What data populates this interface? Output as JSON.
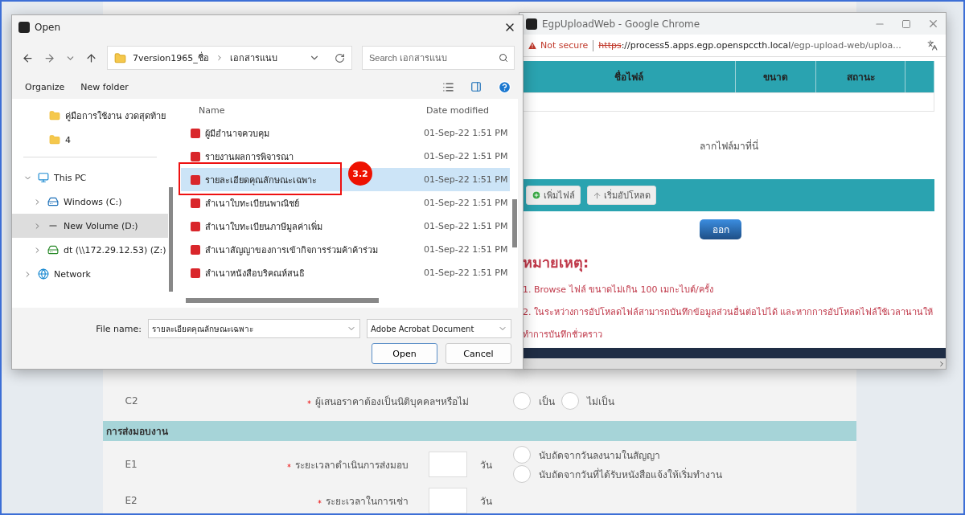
{
  "open_dialog": {
    "title": "Open",
    "path": [
      "7version1965_ชื่อ",
      "เอกสารแนบ"
    ],
    "search": {
      "placeholder": "Search เอกสารแนบ"
    },
    "toolbar": [
      "Organize",
      "New folder"
    ],
    "nav": [
      {
        "label": "คู่มือการใช้งาน งวดสุดท้าย",
        "kind": "folder",
        "selected": false
      },
      {
        "label": "4",
        "kind": "folder",
        "selected": false
      },
      {
        "label": "This PC",
        "kind": "pc",
        "selected": false,
        "expanded": true,
        "children": [
          {
            "label": "Windows (C:)",
            "kind": "system-drive",
            "selected": false,
            "expanded": false
          },
          {
            "label": "New Volume (D:)",
            "kind": "drive",
            "selected": true,
            "expanded": false
          },
          {
            "label": "dt (\\\\172.29.12.53) (Z:)",
            "kind": "network-drive",
            "selected": false,
            "expanded": false
          }
        ]
      },
      {
        "label": "Network",
        "kind": "network",
        "selected": false,
        "expanded": false
      }
    ],
    "columns": [
      "Name",
      "Date modified"
    ],
    "files": [
      {
        "name": "ผู้มีอำนาจควบคุม",
        "date": "01-Sep-22 1:51 PM",
        "selected": false
      },
      {
        "name": "รายงานผลการพิจารณา",
        "date": "01-Sep-22 1:51 PM",
        "selected": false
      },
      {
        "name": "รายละเอียดคุณลักษณะเฉพาะ",
        "date": "01-Sep-22 1:51 PM",
        "selected": true
      },
      {
        "name": "สำเนาใบทะเบียนพาณิชย์",
        "date": "01-Sep-22 1:51 PM",
        "selected": false
      },
      {
        "name": "สำเนาใบทะเบียนภาษีมูลค่าเพิ่ม",
        "date": "01-Sep-22 1:51 PM",
        "selected": false
      },
      {
        "name": "สำเนาสัญญาของการเข้ากิจการร่วมค้าค้าร่วม",
        "date": "01-Sep-22 1:51 PM",
        "selected": false
      },
      {
        "name": "สำเนาหนังสือบริคณห์สนธิ",
        "date": "01-Sep-22 1:51 PM",
        "selected": false
      }
    ],
    "file_name_label": "File name:",
    "file_name": "รายละเอียดคุณลักษณะเฉพาะ",
    "file_type": "Adobe Acrobat Document",
    "buttons": [
      "Open",
      "Cancel"
    ]
  },
  "annotation": {
    "label": "3.2"
  },
  "browser": {
    "title": "EgpUploadWeb - Google Chrome",
    "security": "Not secure",
    "url_scheme": "https",
    "url_host": "://process5.apps.egp.openspccth.local",
    "url_path": "/egp-upload-web/uploa...",
    "columns": [
      "ชื่อไฟล์",
      "ขนาด",
      "สถานะ"
    ],
    "drop_hint": "ลากไฟล์มาที่นี่",
    "toolbar": [
      "เพิ่มไฟล์",
      "เริ่มอัปโหลด"
    ],
    "exit_button": "ออก",
    "notes_title": "หมายเหตุ:",
    "notes": [
      "1. Browse ไฟล์ ขนาดไม่เกิน 100 เมกะไบต์/ครั้ง",
      "2. ในระหว่างการอัปโหลดไฟล์สามารถบันทึกข้อมูลส่วนอื่นต่อไปได้ และหากการอัปโหลดไฟล์ใช้เวลานานให้ทำการบันทึกชั่วคราว"
    ]
  },
  "form": [
    {
      "kind": "choice",
      "code": "C2",
      "label": "ผู้เสนอราคาต้องเป็นนิติบุคคลฯหรือไม่",
      "required": true,
      "options": [
        {
          "label": "เป็น",
          "selected": false
        },
        {
          "label": "ไม่เป็น",
          "selected": false
        }
      ]
    },
    {
      "kind": "section",
      "label": "การส่งมอบงาน"
    },
    {
      "kind": "duration",
      "code": "E1",
      "label": "ระยะเวลาดำเนินการส่งมอบ",
      "required": true,
      "unit": "วัน",
      "options": [
        {
          "label": "นับถัดจากวันลงนามในสัญญา",
          "selected": false
        },
        {
          "label": "นับถัดจากวันที่ได้รับหนังสือแจ้งให้เริ่มทำงาน",
          "selected": false
        }
      ]
    },
    {
      "kind": "duration",
      "code": "E2",
      "label": "ระยะเวลาในการเช่า",
      "required": true,
      "unit": "วัน"
    }
  ]
}
